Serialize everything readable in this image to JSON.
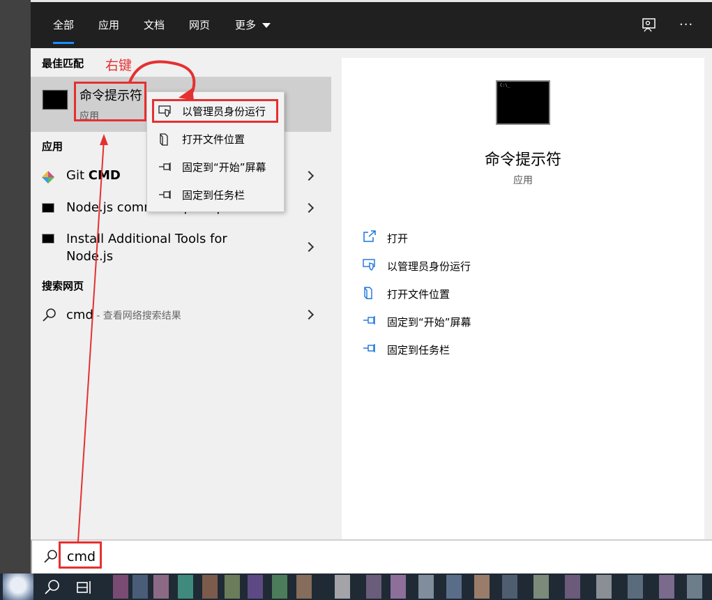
{
  "tabs": [
    {
      "label": "全部"
    },
    {
      "label": "应用"
    },
    {
      "label": "文档"
    },
    {
      "label": "网页"
    },
    {
      "label": "更多"
    }
  ],
  "sections": {
    "best_match": "最佳匹配",
    "apps": "应用",
    "web": "搜索网页"
  },
  "best_match": {
    "title": "命令提示符",
    "subtitle": "应用"
  },
  "apps": [
    {
      "label_prefix": "Git ",
      "label_bold": "CMD",
      "icon": "git-icon"
    },
    {
      "label": "Node.js command prompt",
      "icon": "cmd-icon"
    },
    {
      "label": "Install Additional Tools for Node.js",
      "icon": "cmd-icon"
    }
  ],
  "web": {
    "query": "cmd",
    "hint": " - 查看网络搜索结果"
  },
  "context_menu": [
    {
      "label": "以管理员身份运行",
      "icon": "shield-icon"
    },
    {
      "label": "打开文件位置",
      "icon": "folder-location-icon"
    },
    {
      "label": "固定到“开始”屏幕",
      "icon": "pin-icon"
    },
    {
      "label": "固定到任务栏",
      "icon": "pin-icon"
    }
  ],
  "detail": {
    "title": "命令提示符",
    "subtitle": "应用",
    "actions": [
      {
        "label": "打开",
        "icon": "open-icon"
      },
      {
        "label": "以管理员身份运行",
        "icon": "shield-icon"
      },
      {
        "label": "打开文件位置",
        "icon": "folder-location-icon"
      },
      {
        "label": "固定到“开始”屏幕",
        "icon": "pin-icon"
      },
      {
        "label": "固定到任务栏",
        "icon": "pin-icon"
      }
    ]
  },
  "search": {
    "value": "cmd"
  },
  "annotation": {
    "text": "右键"
  },
  "colors": {
    "accent": "#1a8cff",
    "annotation": "#e53030",
    "selection": "#cfcfcf"
  }
}
